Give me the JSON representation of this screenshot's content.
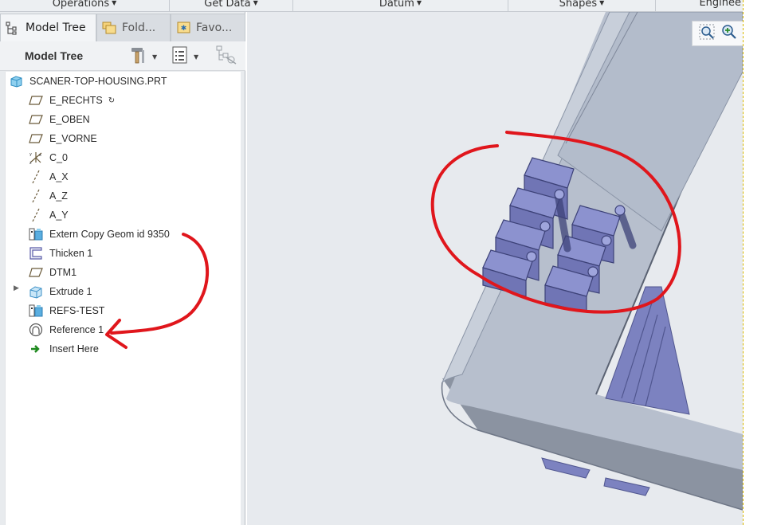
{
  "ribbon": {
    "groups": [
      {
        "label": "Operations"
      },
      {
        "label": "Get Data"
      },
      {
        "label": "Datum"
      },
      {
        "label": "Shapes"
      },
      {
        "label": "Enginee"
      }
    ]
  },
  "navigator": {
    "tabs": [
      {
        "label": "Model Tree",
        "icon": "model-tree-icon",
        "active": true
      },
      {
        "label": "Fold...",
        "icon": "folder-browser-icon"
      },
      {
        "label": "Favo...",
        "icon": "favorites-icon"
      }
    ],
    "header": {
      "title": "Model Tree",
      "settings_icon": "hammer-settings-icon",
      "show_icon": "list-show-icon",
      "filter_icon": "tree-filter-icon"
    },
    "tree": {
      "root": {
        "label": "SCANER-TOP-HOUSING.PRT",
        "icon": "part-icon"
      },
      "items": [
        {
          "label": "E_RECHTS",
          "icon": "datum-plane-icon",
          "regen": "↻"
        },
        {
          "label": "E_OBEN",
          "icon": "datum-plane-icon"
        },
        {
          "label": "E_VORNE",
          "icon": "datum-plane-icon"
        },
        {
          "label": "C_0",
          "icon": "coordinate-system-icon"
        },
        {
          "label": "A_X",
          "icon": "datum-axis-icon"
        },
        {
          "label": "A_Z",
          "icon": "datum-axis-icon"
        },
        {
          "label": "A_Y",
          "icon": "datum-axis-icon"
        },
        {
          "label": "Extern Copy Geom id 9350",
          "icon": "copy-geometry-icon"
        },
        {
          "label": "Thicken 1",
          "icon": "thicken-icon"
        },
        {
          "label": "DTM1",
          "icon": "datum-plane-icon"
        },
        {
          "label": "Extrude 1",
          "icon": "extrude-icon",
          "expandable": true
        },
        {
          "label": "REFS-TEST",
          "icon": "copy-geometry-icon"
        },
        {
          "label": "Reference 1",
          "icon": "reference-icon"
        },
        {
          "label": "Insert Here",
          "icon": "insert-here-arrow-icon"
        }
      ]
    }
  },
  "graphics": {
    "view_toolbar": [
      "zoom-fit-icon",
      "zoom-in-icon"
    ]
  },
  "colors": {
    "annotation": "#e0161c",
    "part_body": "#b3bccb",
    "feature_body": "#7a80be",
    "background": "#e7eaee"
  }
}
